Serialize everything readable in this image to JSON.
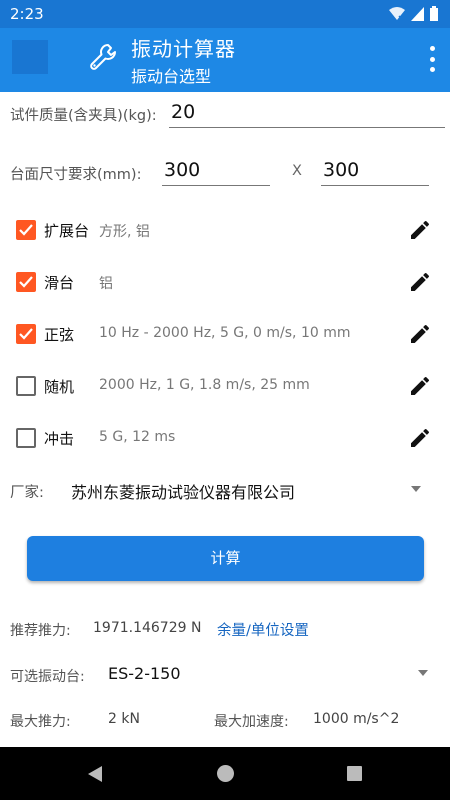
{
  "status_bar": {
    "time": "2:23"
  },
  "app_bar": {
    "title": "振动计算器",
    "subtitle": "振动台选型"
  },
  "mass": {
    "label": "试件质量(含夹具)(kg):",
    "value": "20"
  },
  "table_size": {
    "label": "台面尺寸要求(mm):",
    "width": "300",
    "separator": "X",
    "height": "300"
  },
  "options": [
    {
      "name": "扩展台",
      "desc": "方形, 铝",
      "checked": true
    },
    {
      "name": "滑台",
      "desc": "铝",
      "checked": true
    },
    {
      "name": "正弦",
      "desc": "10 Hz - 2000 Hz, 5 G, 0 m/s, 10 mm",
      "checked": true
    },
    {
      "name": "随机",
      "desc": "2000 Hz, 1 G, 1.8 m/s, 25 mm",
      "checked": false
    },
    {
      "name": "冲击",
      "desc": "5 G, 12 ms",
      "checked": false
    }
  ],
  "vendor": {
    "label": "厂家:",
    "value": "苏州东菱振动试验仪器有限公司"
  },
  "calculate_label": "计算",
  "result": {
    "recommended_label": "推荐推力:",
    "recommended_value": "1971.146729 N",
    "settings_link": "余量/单位设置",
    "shaker_label": "可选振动台:",
    "shaker_value": "ES-2-150",
    "max_force_label": "最大推力:",
    "max_force_value": "2 kN",
    "max_accel_label": "最大加速度:",
    "max_accel_value": "1000 m/s^2"
  },
  "colors": {
    "primary": "#1e88e5",
    "primary_dark": "#1976d2",
    "accent": "#ff5722",
    "link": "#1565c0"
  }
}
